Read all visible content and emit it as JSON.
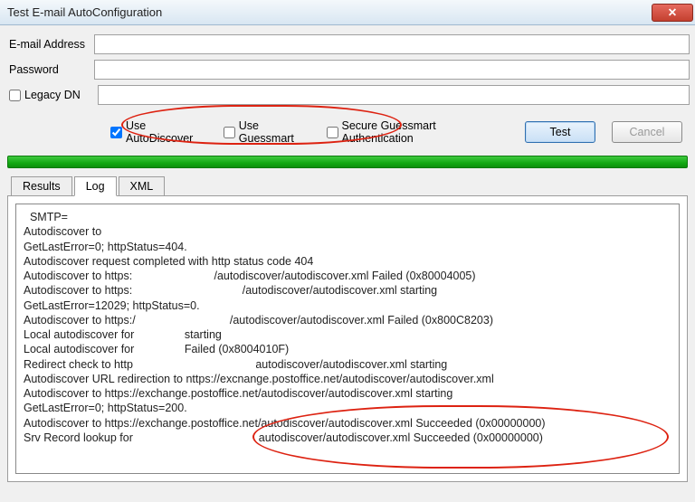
{
  "window": {
    "title": "Test E-mail AutoConfiguration"
  },
  "fields": {
    "email_label": "E-mail Address",
    "email_value": "",
    "password_label": "Password",
    "password_value": "",
    "legacy_label": "Legacy DN",
    "legacy_value": ""
  },
  "options": {
    "autodiscover_label": "Use AutoDiscover",
    "autodiscover_checked": true,
    "guessmart_label": "Use Guessmart",
    "guessmart_checked": false,
    "secure_label": "Secure Guessmart Authentication",
    "secure_checked": false
  },
  "buttons": {
    "test": "Test",
    "cancel": "Cancel"
  },
  "tabs": {
    "results": "Results",
    "log": "Log",
    "xml": "XML",
    "active": "log"
  },
  "log_lines": [
    "  SMTP=",
    "Autodiscover to",
    "GetLastError=0; httpStatus=404.",
    "Autodiscover request completed with http status code 404",
    "Autodiscover to https:                          /autodiscover/autodiscover.xml Failed (0x80004005)",
    "Autodiscover to https:                                   /autodiscover/autodiscover.xml starting",
    "GetLastError=12029; httpStatus=0.",
    "Autodiscover to https:/                              /autodiscover/autodiscover.xml Failed (0x800C8203)",
    "Local autodiscover for                starting",
    "Local autodiscover for                Failed (0x8004010F)",
    "Redirect check to http                                       autodiscover/autodiscover.xml starting",
    "Autodiscover URL redirection to nttps://excnange.postoffice.net/autodiscover/autodiscover.xml",
    "Autodiscover to https://exchange.postoffice.net/autodiscover/autodiscover.xml starting",
    "GetLastError=0; httpStatus=200.",
    "Autodiscover to https://exchange.postoffice.net/autodiscover/autodiscover.xml Succeeded (0x00000000)",
    "Srv Record lookup for                                        autodiscover/autodiscover.xml Succeeded (0x00000000)"
  ]
}
